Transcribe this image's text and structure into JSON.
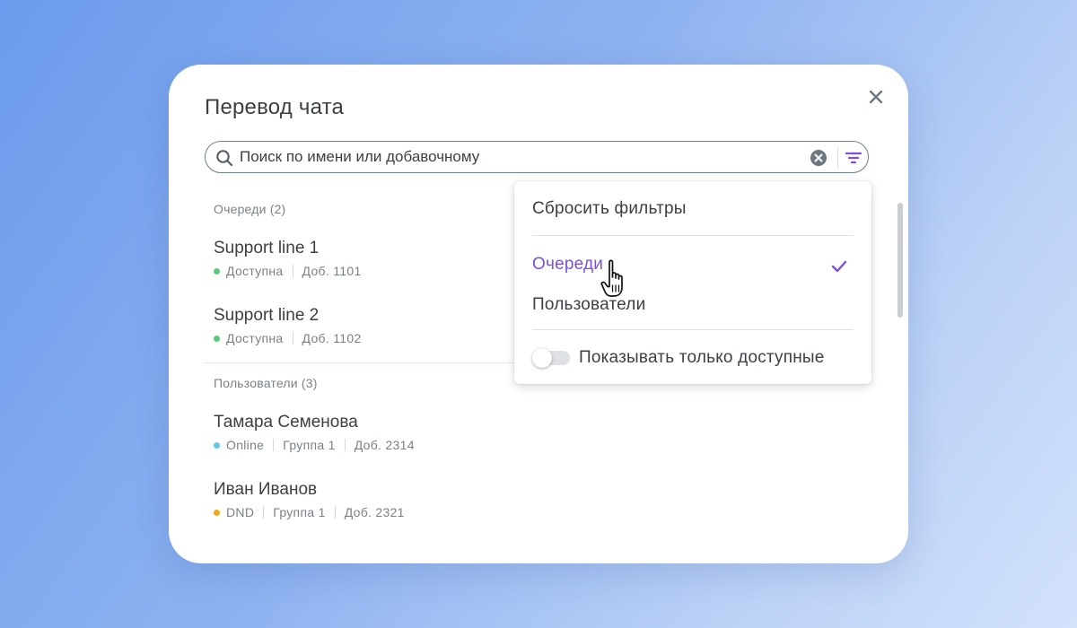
{
  "dialog": {
    "title": "Перевод чата",
    "close_icon": "close-icon",
    "search": {
      "placeholder": "Поиск по имени или добавочному",
      "icons": [
        "search-icon",
        "clear-icon",
        "filter-icon"
      ]
    }
  },
  "sections": [
    {
      "header": "Очереди (2)",
      "items": [
        {
          "name": "Support line 1",
          "status": "Доступна",
          "status_color": "#5bc97d",
          "meta": [
            "Доб. 1101"
          ]
        },
        {
          "name": "Support line 2",
          "status": "Доступна",
          "status_color": "#5bc97d",
          "meta": [
            "Доб. 1102"
          ]
        }
      ]
    },
    {
      "header": "Пользователи (3)",
      "items": [
        {
          "name": "Тамара Семенова",
          "status": "Online",
          "status_color": "#5fc8e8",
          "meta": [
            "Группа 1",
            "Доб. 2314"
          ]
        },
        {
          "name": "Иван Иванов",
          "status": "DND",
          "status_color": "#f0a81e",
          "meta": [
            "Группа 1",
            "Доб. 2321"
          ]
        }
      ]
    }
  ],
  "filter_menu": {
    "reset": "Сбросить фильтры",
    "options": [
      {
        "label": "Очереди",
        "checked": true
      },
      {
        "label": "Пользователи",
        "checked": false
      }
    ],
    "toggle": {
      "label": "Показывать только доступные",
      "on": false
    }
  },
  "colors": {
    "accent": "#7b4fe0",
    "text": "#3c3f44",
    "muted": "#7a8086"
  }
}
